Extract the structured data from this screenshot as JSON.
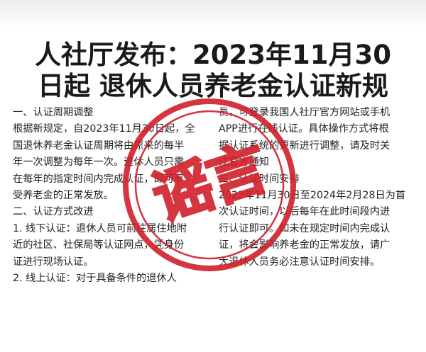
{
  "title": {
    "line1": "人社厅发布：2023年11月30",
    "line2": "日起 退休人员养老金认证新规"
  },
  "left_column": {
    "lines": [
      "一、认证周期调整",
      "根据新规定，自2023年11月30日起，全",
      "国退休养老金认证周期将由原来的每半",
      "年一次调整为每年一次。退休人员只需",
      "在每年的指定时间内完成认证，即可享",
      "受养老金的正常发放。",
      "二、认证方式改进",
      "1. 线下认证：退休人员可前往居住地附",
      "近的社区、社保局等认证网点，凭身份",
      "证进行现场认证。",
      "2. 线上认证：对于具备条件的退休人"
    ]
  },
  "right_column": {
    "lines": [
      "员，可登录我国人社厅官方网站或手机",
      "APP进行在线认证。具体操作方式将根",
      "据认证系统的更新进行调整，请及时关",
      "注官方通知",
      "三、认证时间安排",
      "2023年11月30日至2024年2月28日为首",
      "次认证时间，以后每年在此时间段内进",
      "行认证即可。如未在规定时间内完成认",
      "证，将会影响养老金的正常发放，请广",
      "大退休人员务必注意认证时间安排。"
    ]
  },
  "stamp": {
    "text": "谣言",
    "color": "#d0202a"
  }
}
